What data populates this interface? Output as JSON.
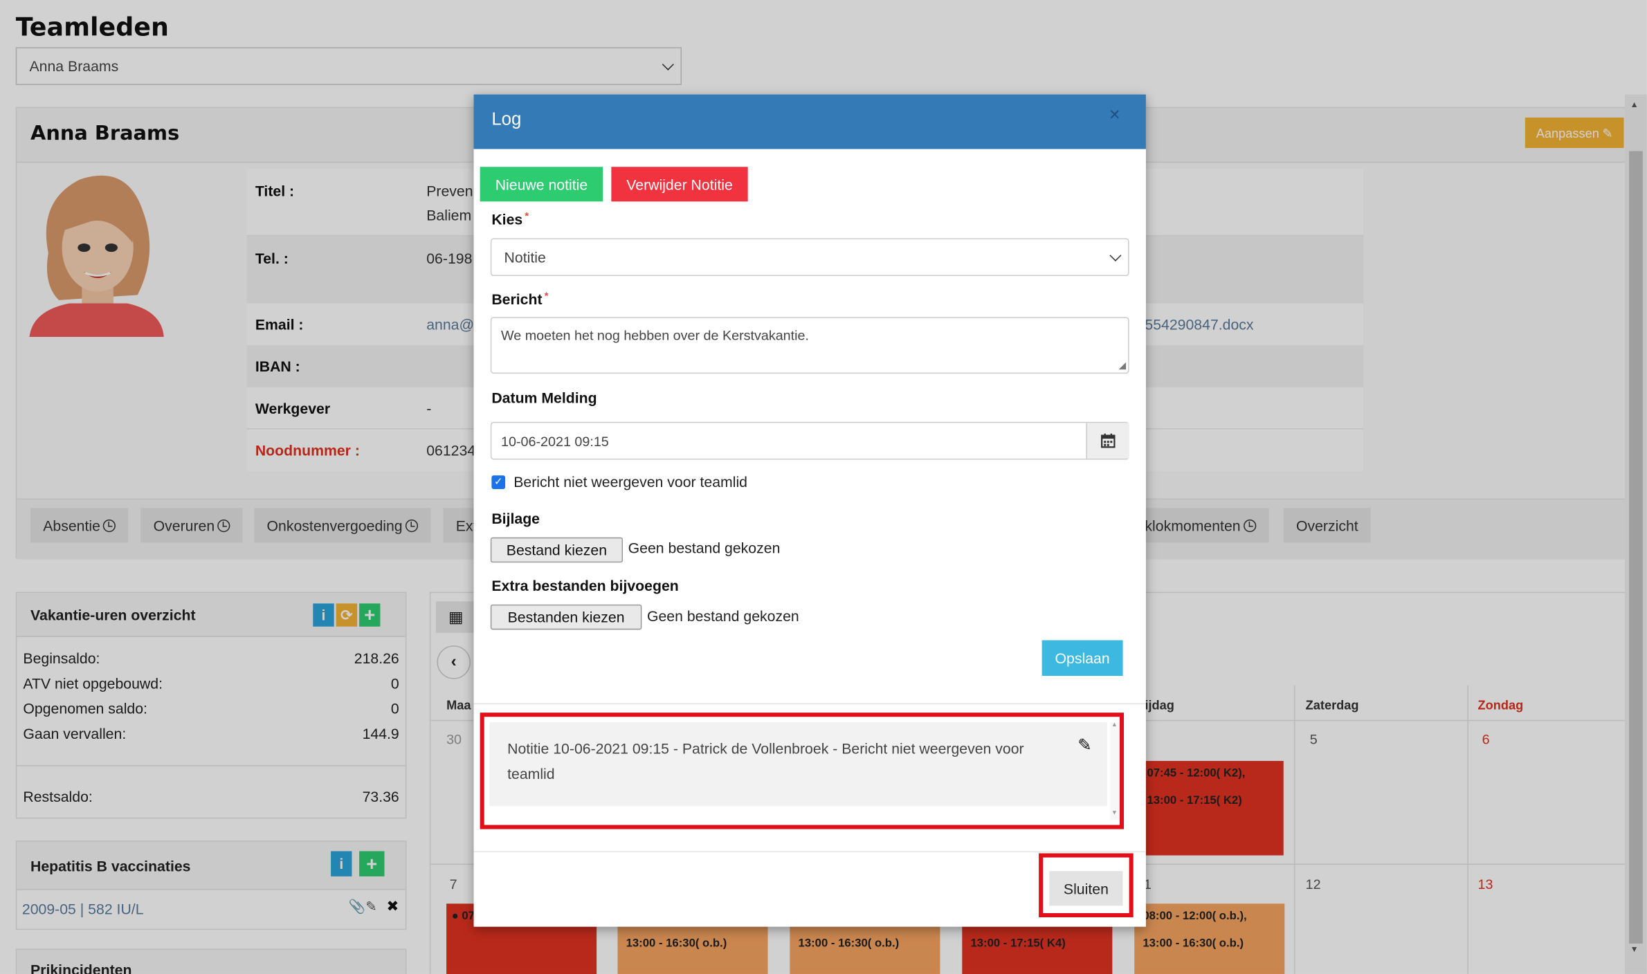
{
  "page": {
    "title": "Teamleden",
    "member_select": "Anna Braams"
  },
  "profile": {
    "name": "Anna Braams",
    "edit_button": "Aanpassen",
    "fields": [
      {
        "label": "Titel :",
        "value": "Preven",
        "value2": "Baliem"
      },
      {
        "label": "Tel. :",
        "value": "06-198"
      },
      {
        "label": "Email :",
        "value": "anna@",
        "extra": "554290847.docx"
      },
      {
        "label": "IBAN :",
        "value": ""
      },
      {
        "label": "Werkgever",
        "value": "-"
      },
      {
        "label": "Noodnummer :",
        "value": "061234"
      }
    ]
  },
  "tabs": [
    "Absentie",
    "Overuren",
    "Onkostenvergoeding",
    "Ext",
    "klokmomenten",
    "Overzicht"
  ],
  "vakantie": {
    "title": "Vakantie-uren overzicht",
    "rows": [
      {
        "label": "Beginsaldo:",
        "value": "218.26"
      },
      {
        "label": "ATV niet opgebouwd:",
        "value": "0"
      },
      {
        "label": "Opgenomen saldo:",
        "value": "0"
      },
      {
        "label": "Gaan vervallen:",
        "value": "144.9"
      }
    ],
    "rest": {
      "label": "Restsaldo:",
      "value": "73.36"
    }
  },
  "hepatitis": {
    "title": "Hepatitis B vaccinaties",
    "entry": "2009-05 | 582 IU/L"
  },
  "prik": {
    "title": "Prikincidenten"
  },
  "calendar": {
    "days": [
      "Maa",
      "ijdag",
      "Zaterdag",
      "Zondag"
    ],
    "week1": {
      "n1": "30",
      "n5": "5",
      "n6": "6",
      "fri_event1": "07:45 - 12:00( K2),",
      "fri_event2": "13:00 - 17:15( K2)"
    },
    "week2": {
      "n1": "7",
      "n4": "1",
      "n5": "12",
      "n6": "13",
      "mon_event": "07:",
      "tue_event": "13:00 - 16:30( o.b.)",
      "wed_event": "13:00 - 16:30( o.b.)",
      "thu_event": "13:00 - 17:15( K4)",
      "fri_event1": "08:00 - 12:00( o.b.),",
      "fri_event2": "13:00 - 16:30( o.b.)"
    }
  },
  "modal": {
    "title": "Log",
    "close_icon": "×",
    "new_note": "Nieuwe notitie",
    "delete_note": "Verwijder Notitie",
    "kies_label": "Kies",
    "kies_value": "Notitie",
    "bericht_label": "Bericht",
    "bericht_value": "We moeten het nog hebben over de Kerstvakantie.",
    "datum_label": "Datum Melding",
    "datum_value": "10-06-2021 09:15",
    "checkbox_label": "Bericht niet weergeven voor teamlid",
    "bijlage_label": "Bijlage",
    "bijlage_button": "Bestand kiezen",
    "bijlage_status": "Geen bestand gekozen",
    "extra_label": "Extra bestanden bijvoegen",
    "extra_button": "Bestanden kiezen",
    "extra_status": "Geen bestand gekozen",
    "save": "Opslaan",
    "log_entry": "Notitie 10-06-2021 09:15 - Patrick de Vollenbroek - Bericht niet weergeven voor teamlid",
    "close_button": "Sluiten"
  },
  "colors": {
    "modal_header": "#337ab7",
    "green": "#2ecc71",
    "red": "#e74c3c",
    "save": "#3db8e0",
    "edit": "#f5b335",
    "highlight": "#e0101a",
    "event_red": "#e23322",
    "event_orange": "#f7a461"
  }
}
